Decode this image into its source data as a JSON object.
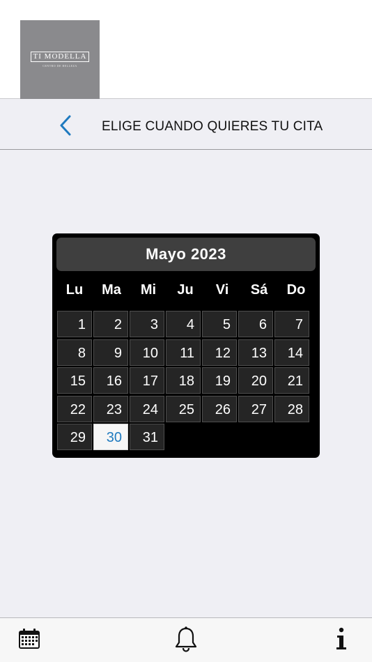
{
  "brand": {
    "name": "TI MODELLA",
    "tagline": "CENTRO DE BELLEZA"
  },
  "nav": {
    "title": "ELIGE CUANDO QUIERES TU CITA",
    "back_icon": "chevron-left-icon"
  },
  "calendar": {
    "month_label": "Mayo 2023",
    "weekdays": [
      "Lu",
      "Ma",
      "Mi",
      "Ju",
      "Vi",
      "Sá",
      "Do"
    ],
    "days": [
      "1",
      "2",
      "3",
      "4",
      "5",
      "6",
      "7",
      "8",
      "9",
      "10",
      "11",
      "12",
      "13",
      "14",
      "15",
      "16",
      "17",
      "18",
      "19",
      "20",
      "21",
      "22",
      "23",
      "24",
      "25",
      "26",
      "27",
      "28",
      "29",
      "30",
      "31"
    ],
    "first_weekday_index": 0,
    "selected_day": "30"
  },
  "tabbar": {
    "items": [
      {
        "icon": "calendar-icon"
      },
      {
        "icon": "bell-icon"
      },
      {
        "icon": "info-icon"
      }
    ]
  },
  "colors": {
    "accent": "#1f7abf",
    "calendar_bg": "#000000",
    "cell_bg": "#252525"
  }
}
